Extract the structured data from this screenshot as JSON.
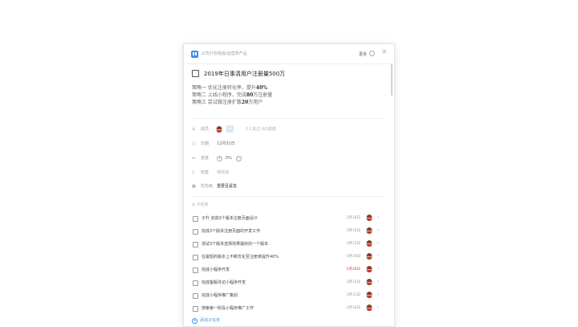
{
  "header": {
    "breadcrumb": "公司计划看版/运营类产品",
    "more_label": "更多"
  },
  "task": {
    "title": "2019年日事清用户注册量500万",
    "description": [
      {
        "prefix": "策略一 优化注册转化率，提升",
        "highlight": "40%",
        "suffix": ""
      },
      {
        "prefix": "策略二 上线小程序，完成",
        "highlight": "80",
        "suffix": "万注册量"
      },
      {
        "prefix": "策略三 尝试做注册扩散",
        "highlight": "20",
        "suffix": "万用户"
      }
    ]
  },
  "properties": {
    "members": {
      "label": "成员",
      "count_text": "1人关注 0/1完成"
    },
    "deadline": {
      "label": "日期",
      "value": "12月31日"
    },
    "progress": {
      "label": "进度",
      "value": "0%"
    },
    "tags": {
      "label": "标签",
      "value": "待添加"
    },
    "priority": {
      "label": "优先级",
      "value": "重要且紧急"
    }
  },
  "subtasks": {
    "header": "子任务",
    "add_label": "添加子任务",
    "items": [
      {
        "name": "子升 完成3个版本注册页面设计",
        "date": "2月28日",
        "overdue": false
      },
      {
        "name": "完成3个版本注册页面的开发工作",
        "date": "3月10日",
        "overdue": false
      },
      {
        "name": "测试3个版本选择效果最好的一个版本",
        "date": "3月15日",
        "overdue": false
      },
      {
        "name": "在最短的版本上不断优化至注册率提升40%",
        "date": "4月30日",
        "overdue": false
      },
      {
        "name": "完成小程序开发",
        "date": "2月28日",
        "overdue": true
      },
      {
        "name": "完成客服寻访小程序开发",
        "date": "3月15日",
        "overdue": false
      },
      {
        "name": "完成小程序推广策划",
        "date": "3月31日",
        "overdue": false
      },
      {
        "name": "搜索第一阶段小程序推广工作",
        "date": "4月30日",
        "overdue": false
      }
    ]
  },
  "colors": {
    "accent": "#3d8ef0",
    "overdue": "#e0453a"
  }
}
